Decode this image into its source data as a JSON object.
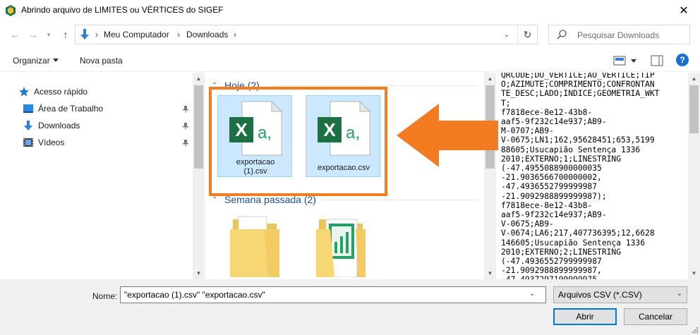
{
  "window": {
    "title": "Abrindo arquivo de LIMITES ou VÉRTICES do SIGEF",
    "close": "✕"
  },
  "address": {
    "segments": [
      "Meu Computador",
      "Downloads"
    ],
    "separator": "›",
    "refresh": "↻"
  },
  "search": {
    "placeholder": "Pesquisar Downloads"
  },
  "toolbar": {
    "organize": "Organizar",
    "new_folder": "Nova pasta",
    "help": "?"
  },
  "sidebar": {
    "items": [
      {
        "label": "Acesso rápido",
        "icon": "star-icon"
      },
      {
        "label": "Área de Trabalho",
        "icon": "desktop-icon",
        "pinned": true
      },
      {
        "label": "Downloads",
        "icon": "download-icon",
        "pinned": true
      },
      {
        "label": "Vídeos",
        "icon": "video-icon",
        "pinned": true
      }
    ]
  },
  "files": {
    "groups": [
      {
        "label": "Hoje (2)"
      },
      {
        "label": "Semana passada (2)"
      }
    ],
    "today": [
      {
        "name": "exportacao\n(1).csv",
        "selected": true
      },
      {
        "name": "exportacao.csv",
        "selected": true
      }
    ],
    "icon_letters": {
      "x": "X",
      "a": "a,"
    }
  },
  "preview": {
    "text": "QRCODE;DO_VERTICE;AO_VERTICE;TIP\nO;AZIMUTE;COMPRIMENTO;CONFRONTAN\nTE_DESC;LADO;INDICE;GEOMETRIA_WKT\nT;\nf7818ece-8e12-43b8-\naaf5-9f232c14e937;AB9-\nM-0707;AB9-\nV-0675;LN1;162,95628451;653,5199\n88605;Usucapião Sentença 1336\n2010;EXTERNO;1;LINESTRING\n(-47.4955088900000035\n-21.9036566700000002,\n-47.4936552799999987\n-21.9092988899999987);\nf7818ece-8e12-43b8-\naaf5-9f232c14e937;AB9-\nV-0675;AB9-\nV-0674;LA6;217,407736395;12,6628\n146605;Usucapião Sentença 1336\n2010;EXTERNO;2;LINESTRING\n(-47.4936552799999987\n-21.9092988899999987,\n-47.4937297199999975"
  },
  "bottom": {
    "name_label": "Nome:",
    "name_value": "\"exportacao (1).csv\" \"exportacao.csv\"",
    "filter": "Arquivos CSV (*.CSV)",
    "open": "Abrir",
    "cancel": "Cancelar"
  },
  "colors": {
    "highlight": "#f47c20",
    "selection": "#cce8ff",
    "excel_green": "#1d7044",
    "accent": "#0078d7"
  }
}
